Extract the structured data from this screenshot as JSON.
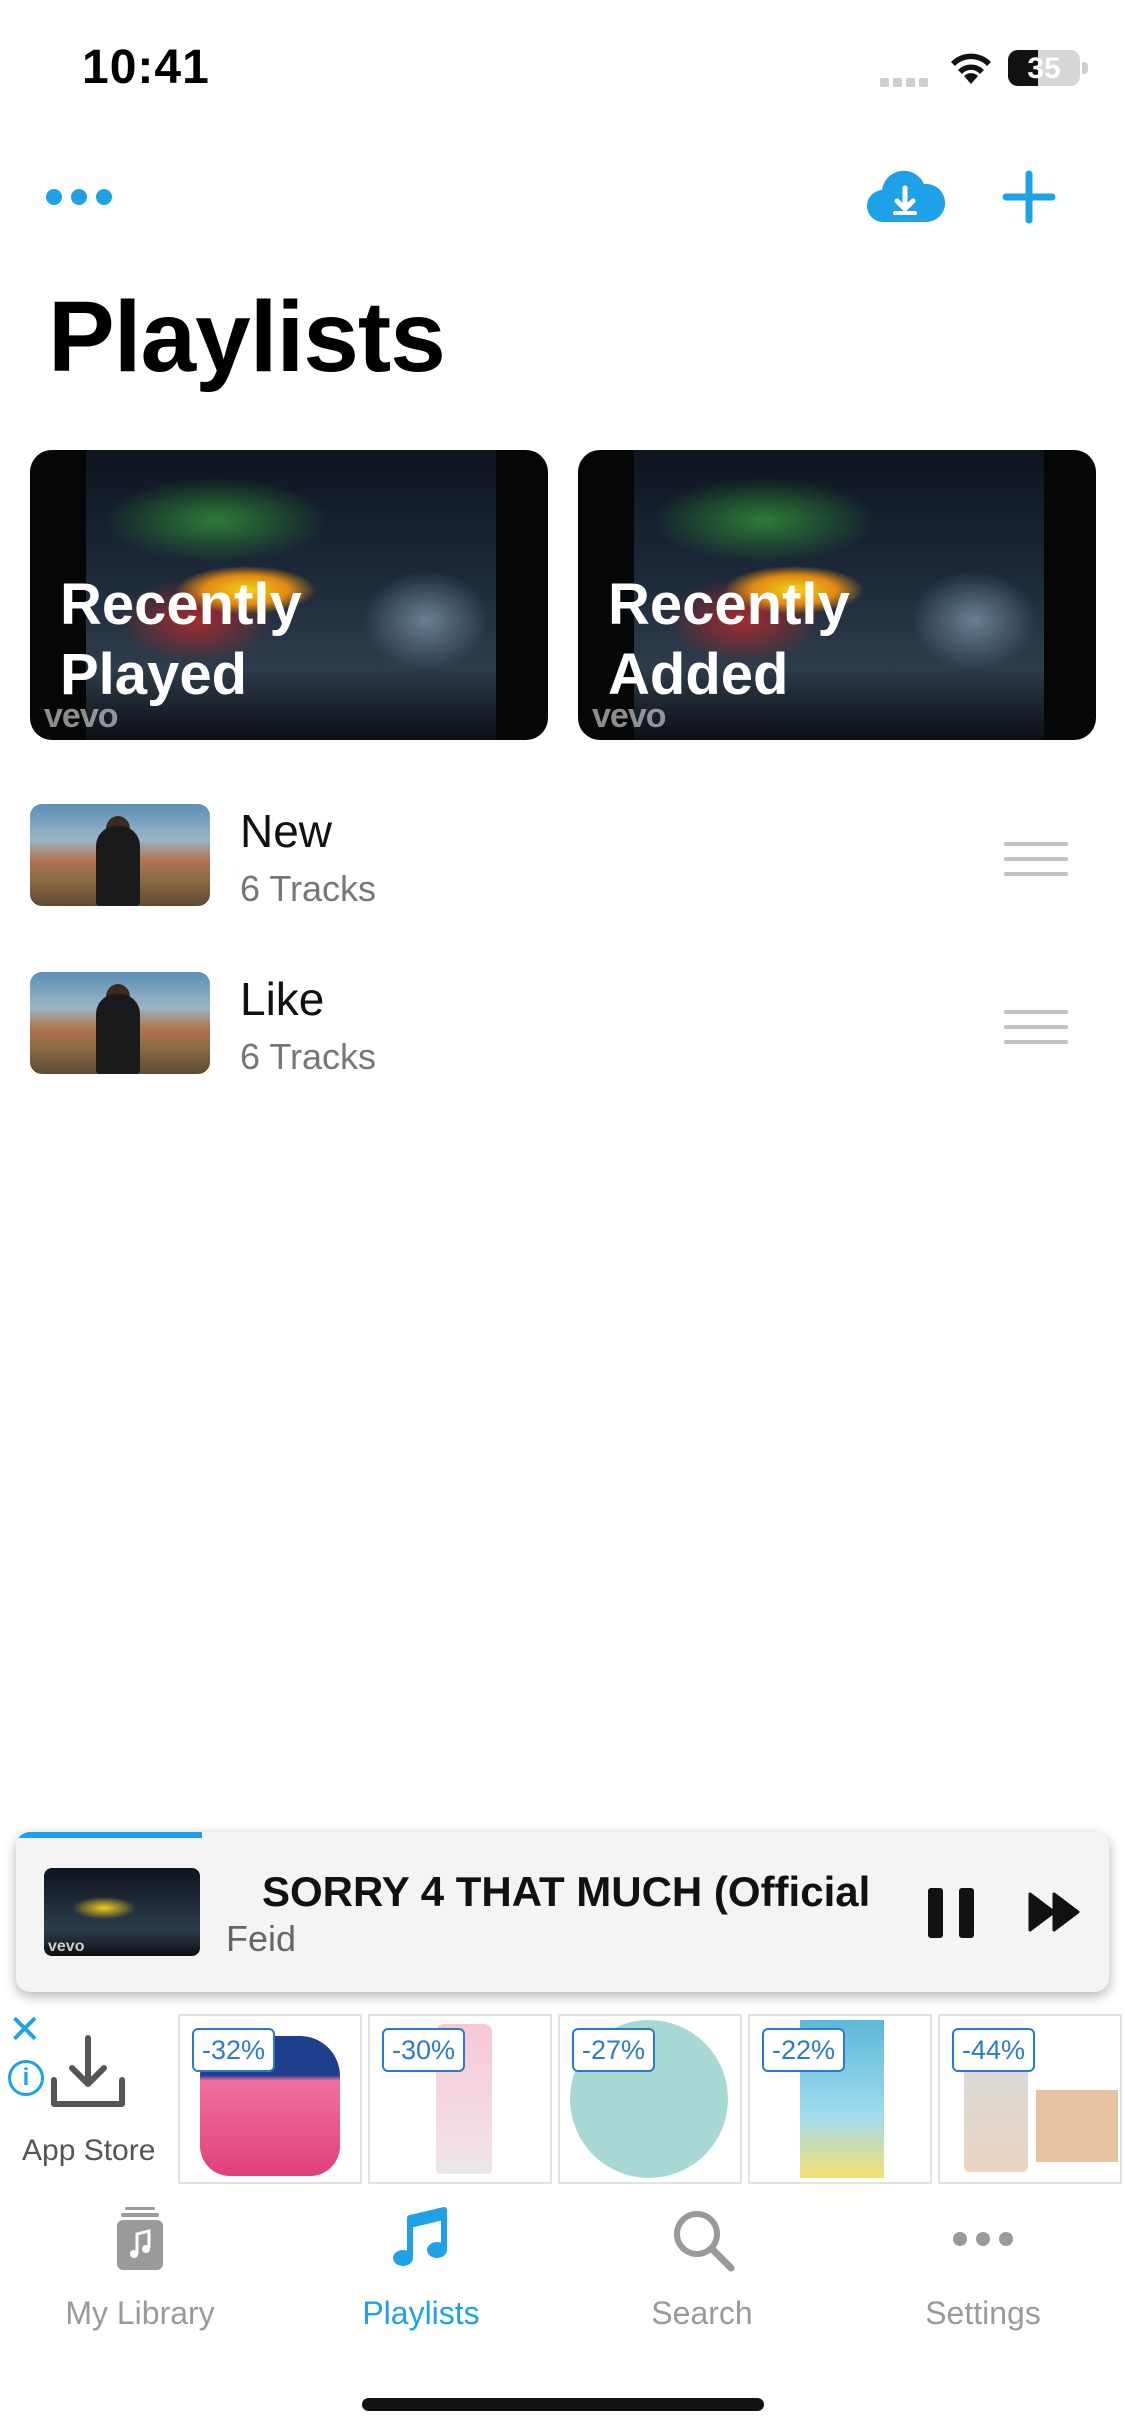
{
  "status_bar": {
    "time": "10:41",
    "battery": "35"
  },
  "page": {
    "title": "Playlists"
  },
  "smart_playlists": [
    {
      "label_line1": "Recently",
      "label_line2": "Played",
      "watermark": "vevo"
    },
    {
      "label_line1": "Recently",
      "label_line2": "Added",
      "watermark": "vevo"
    }
  ],
  "playlists": [
    {
      "title": "New",
      "subtitle": "6 Tracks"
    },
    {
      "title": "Like",
      "subtitle": "6 Tracks"
    }
  ],
  "now_playing": {
    "title": "SORRY 4 THAT MUCH (Official",
    "artist": "Feid",
    "thumb_watermark": "vevo",
    "progress_fraction": 0.17
  },
  "ad": {
    "close": "✕",
    "info": "i",
    "store_label": "App Store",
    "tiles": [
      {
        "discount": "-32%"
      },
      {
        "discount": "-30%"
      },
      {
        "discount": "-27%"
      },
      {
        "discount": "-22%"
      },
      {
        "discount": "-44%"
      }
    ]
  },
  "tabs": [
    {
      "label": "My Library",
      "icon": "library-icon",
      "active": false
    },
    {
      "label": "Playlists",
      "icon": "music-note-icon",
      "active": true
    },
    {
      "label": "Search",
      "icon": "search-icon",
      "active": false
    },
    {
      "label": "Settings",
      "icon": "more-icon",
      "active": false
    }
  ],
  "colors": {
    "accent": "#1ea1e6",
    "inactive": "#9a9a9a"
  }
}
